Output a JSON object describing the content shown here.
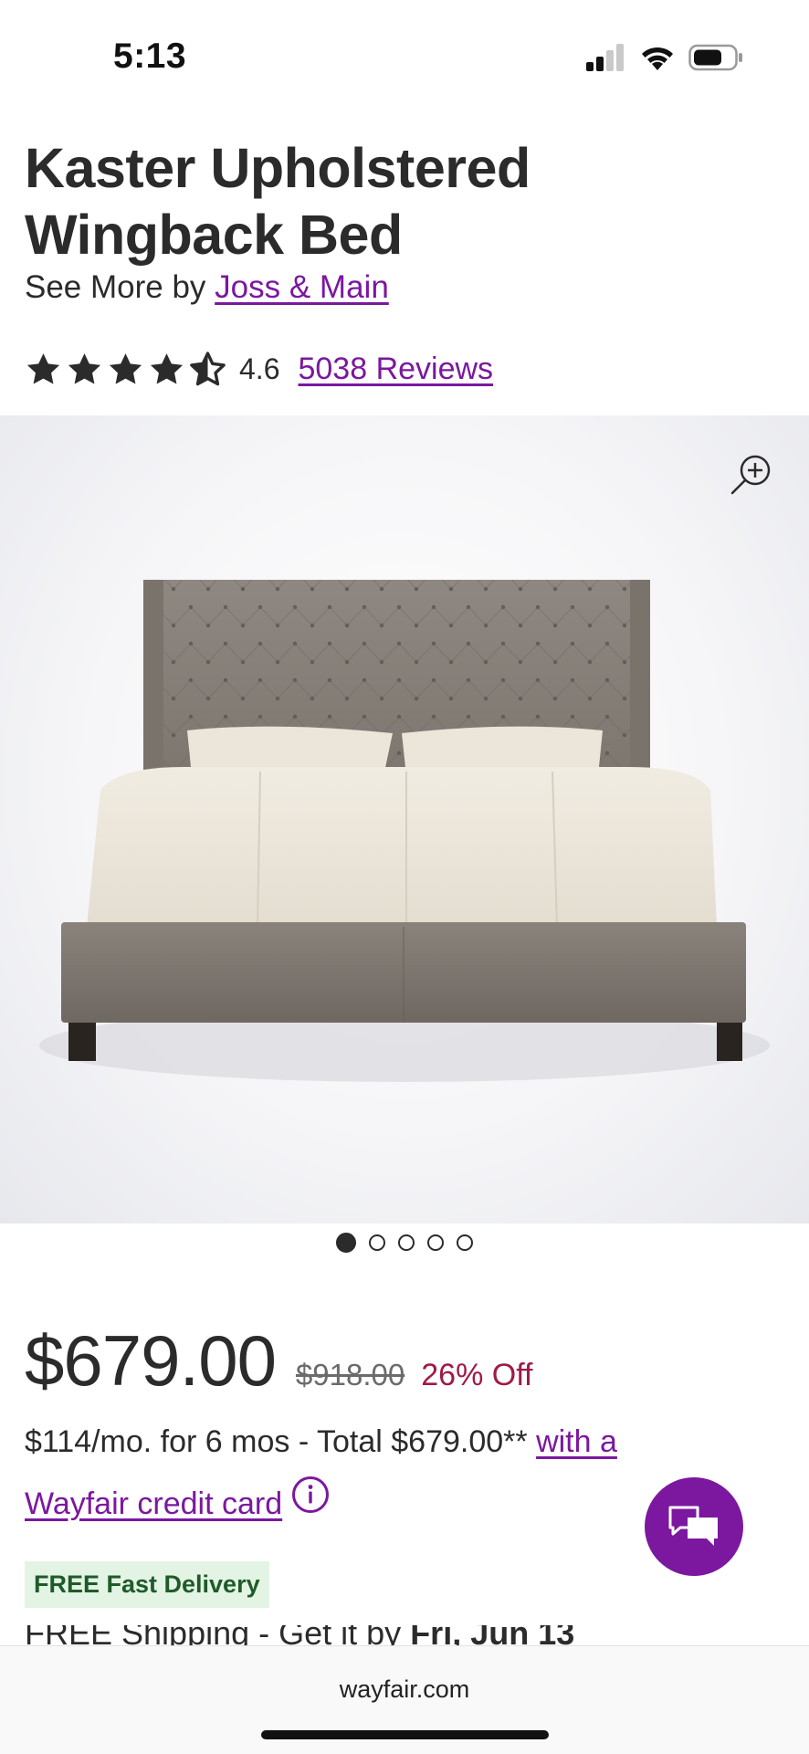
{
  "status_bar": {
    "time": "5:13"
  },
  "product": {
    "title": "Kaster Upholstered Wingback Bed",
    "see_more_prefix": "See More by",
    "brand": "Joss & Main",
    "rating": "4.6",
    "rating_stars": 4.5,
    "reviews": "5038 Reviews"
  },
  "gallery": {
    "image_count": 5,
    "active_index": 0
  },
  "pricing": {
    "price": "$679.00",
    "old_price": "$918.00",
    "discount": "26% Off",
    "financing_text": "$114/mo. for 6 mos - Total $679.00**",
    "financing_link": "with a Wayfair credit card"
  },
  "delivery": {
    "badge": "FREE Fast Delivery",
    "shipping_prefix": "FREE Shipping - Get it by",
    "shipping_date": "Fri, Jun 13"
  },
  "browser": {
    "url": "wayfair.com"
  },
  "colors": {
    "accent": "#7b189f",
    "discount": "#a01a48",
    "badge_bg": "#e3f4e4",
    "badge_text": "#1f5b2a"
  },
  "icons": [
    "signal-icon",
    "wifi-icon",
    "battery-icon",
    "star-icon",
    "zoom-in-icon",
    "info-icon",
    "chat-icon"
  ]
}
